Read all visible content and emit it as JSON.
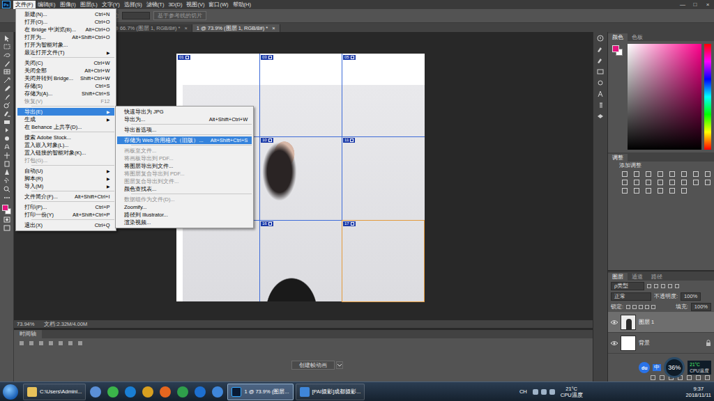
{
  "app": {
    "logo": "Ps"
  },
  "menubar": [
    {
      "label": "文件(F)",
      "selected": true
    },
    {
      "label": "编辑(E)",
      "selected": false
    },
    {
      "label": "图像(I)",
      "selected": false
    },
    {
      "label": "图层(L)",
      "selected": false
    },
    {
      "label": "文字(Y)",
      "selected": false
    },
    {
      "label": "选择(S)",
      "selected": false
    },
    {
      "label": "滤镜(T)",
      "selected": false
    },
    {
      "label": "3D(D)",
      "selected": false
    },
    {
      "label": "视图(V)",
      "selected": false
    },
    {
      "label": "窗口(W)",
      "selected": false
    },
    {
      "label": "帮助(H)",
      "selected": false
    }
  ],
  "window_controls": [
    "—",
    "□",
    "×"
  ],
  "options_bar": {
    "height_label": "高度:",
    "guide_button": "基于参考线的切片"
  },
  "doc_tabs": [
    {
      "label": "1 @ 66.7% (图层 1, RGB/8#) *",
      "close": "×",
      "selected": false
    },
    {
      "label": "1 @ 73.9% (图层 1, RGB/8#) *",
      "close": "×",
      "selected": true
    }
  ],
  "file_menu": [
    {
      "kind": "item",
      "label": "新建(N)...",
      "shortcut": "Ctrl+N",
      "disabled": false,
      "selected": false
    },
    {
      "kind": "item",
      "label": "打开(O)...",
      "shortcut": "Ctrl+O",
      "disabled": false,
      "selected": false
    },
    {
      "kind": "item",
      "label": "在 Bridge 中浏览(B)...",
      "shortcut": "Alt+Ctrl+O",
      "disabled": false,
      "selected": false
    },
    {
      "kind": "item",
      "label": "打开为...",
      "shortcut": "Alt+Shift+Ctrl+O",
      "disabled": false,
      "selected": false
    },
    {
      "kind": "item",
      "label": "打开为智能对象...",
      "disabled": false,
      "selected": false
    },
    {
      "kind": "item",
      "label": "最近打开文件(T)",
      "arrow": "▶",
      "disabled": false,
      "selected": false
    },
    {
      "kind": "separator"
    },
    {
      "kind": "item",
      "label": "关闭(C)",
      "shortcut": "Ctrl+W",
      "disabled": false,
      "selected": false
    },
    {
      "kind": "item",
      "label": "关闭全部",
      "shortcut": "Alt+Ctrl+W",
      "disabled": false,
      "selected": false
    },
    {
      "kind": "item",
      "label": "关闭并转到 Bridge...",
      "shortcut": "Shift+Ctrl+W",
      "disabled": false,
      "selected": false
    },
    {
      "kind": "item",
      "label": "存储(S)",
      "shortcut": "Ctrl+S",
      "disabled": false,
      "selected": false
    },
    {
      "kind": "item",
      "label": "存储为(A)...",
      "shortcut": "Shift+Ctrl+S",
      "disabled": false,
      "selected": false
    },
    {
      "kind": "item",
      "label": "恢复(V)",
      "shortcut": "F12",
      "disabled": true,
      "selected": false
    },
    {
      "kind": "separator"
    },
    {
      "kind": "item",
      "label": "导出(E)",
      "arrow": "▶",
      "disabled": false,
      "selected": true
    },
    {
      "kind": "item",
      "label": "生成",
      "arrow": "▶",
      "disabled": false,
      "selected": false
    },
    {
      "kind": "item",
      "label": "在 Behance 上共享(D)...",
      "disabled": false,
      "selected": false
    },
    {
      "kind": "separator"
    },
    {
      "kind": "item",
      "label": "搜索 Adobe Stock...",
      "disabled": false,
      "selected": false
    },
    {
      "kind": "item",
      "label": "置入嵌入对象(L)...",
      "disabled": false,
      "selected": false
    },
    {
      "kind": "item",
      "label": "置入链接的智能对象(K)...",
      "disabled": false,
      "selected": false
    },
    {
      "kind": "item",
      "label": "打包(G)...",
      "disabled": true,
      "selected": false
    },
    {
      "kind": "separator"
    },
    {
      "kind": "item",
      "label": "自动(U)",
      "arrow": "▶",
      "disabled": false,
      "selected": false
    },
    {
      "kind": "item",
      "label": "脚本(R)",
      "arrow": "▶",
      "disabled": false,
      "selected": false
    },
    {
      "kind": "item",
      "label": "导入(M)",
      "arrow": "▶",
      "disabled": false,
      "selected": false
    },
    {
      "kind": "separator"
    },
    {
      "kind": "item",
      "label": "文件简介(F)...",
      "shortcut": "Alt+Shift+Ctrl+I",
      "disabled": false,
      "selected": false
    },
    {
      "kind": "separator"
    },
    {
      "kind": "item",
      "label": "打印(P)...",
      "shortcut": "Ctrl+P",
      "disabled": false,
      "selected": false
    },
    {
      "kind": "item",
      "label": "打印一份(Y)",
      "shortcut": "Alt+Shift+Ctrl+P",
      "disabled": false,
      "selected": false
    },
    {
      "kind": "separator"
    },
    {
      "kind": "item",
      "label": "退出(X)",
      "shortcut": "Ctrl+Q",
      "disabled": false,
      "selected": false
    }
  ],
  "export_submenu": [
    {
      "kind": "item",
      "label": "快速导出为 JPG",
      "disabled": false,
      "selected": false
    },
    {
      "kind": "item",
      "label": "导出为...",
      "shortcut": "Alt+Shift+Ctrl+W",
      "disabled": false,
      "selected": false
    },
    {
      "kind": "separator"
    },
    {
      "kind": "item",
      "label": "导出首选项...",
      "disabled": false,
      "selected": false
    },
    {
      "kind": "separator"
    },
    {
      "kind": "item",
      "label": "存储为 Web 所用格式（旧版）...",
      "shortcut": "Alt+Shift+Ctrl+S",
      "disabled": false,
      "selected": true
    },
    {
      "kind": "separator"
    },
    {
      "kind": "item",
      "label": "画板至文件...",
      "disabled": true,
      "selected": false
    },
    {
      "kind": "item",
      "label": "将画板导出到 PDF...",
      "disabled": true,
      "selected": false
    },
    {
      "kind": "item",
      "label": "将图层导出到文件...",
      "disabled": false,
      "selected": false
    },
    {
      "kind": "item",
      "label": "将图层复合导出到 PDF...",
      "disabled": true,
      "selected": false
    },
    {
      "kind": "item",
      "label": "图层复合导出到文件...",
      "disabled": true,
      "selected": false
    },
    {
      "kind": "item",
      "label": "颜色查找表...",
      "disabled": false,
      "selected": false
    },
    {
      "kind": "separator"
    },
    {
      "kind": "item",
      "label": "数据组作为文件(D)...",
      "disabled": true,
      "selected": false
    },
    {
      "kind": "item",
      "label": "Zoomify...",
      "disabled": false,
      "selected": false
    },
    {
      "kind": "item",
      "label": "路径到 Illustrator...",
      "disabled": false,
      "selected": false
    },
    {
      "kind": "item",
      "label": "渲染视频...",
      "disabled": false,
      "selected": false
    }
  ],
  "slices": [
    {
      "label": "01",
      "selected": false
    },
    {
      "label": "03",
      "selected": false
    },
    {
      "label": "05",
      "selected": false
    },
    {
      "label": "10",
      "selected": false
    },
    {
      "label": "11",
      "selected": false
    },
    {
      "label": "16",
      "selected": false
    },
    {
      "label": "17",
      "selected": true
    }
  ],
  "status": {
    "zoom": "73.94%",
    "doc": "文档:2.32M/4.00M"
  },
  "timeline": {
    "title": "时间轴",
    "button": "创建帧动画"
  },
  "color_panel": {
    "tabs": [
      {
        "label": "颜色",
        "selected": true
      },
      {
        "label": "色板",
        "selected": false
      }
    ]
  },
  "adjust_panel": {
    "title": "调整",
    "subtitle": "添加调整"
  },
  "layers_panel": {
    "tabs": [
      {
        "label": "图层",
        "selected": true
      },
      {
        "label": "通道",
        "selected": false
      },
      {
        "label": "路径",
        "selected": false
      }
    ],
    "filter": "ρ类型",
    "blend": "正常",
    "opacity_label": "不透明度:",
    "opacity": "100%",
    "lock_label": "锁定:",
    "fill_label": "填充:",
    "fill": "100%",
    "layers": [
      {
        "name": "图层 1",
        "selected": true,
        "visible": true,
        "locked": false
      },
      {
        "name": "背景",
        "selected": false,
        "visible": true,
        "locked": true
      }
    ]
  },
  "taskbar": {
    "items": [
      {
        "label": "C:\\Users\\Admini...",
        "selected": false
      },
      {
        "label": "1 @ 73.9% (图层...",
        "selected": true
      },
      {
        "label": "[PAI摄影]成都摄影...",
        "selected": false
      }
    ],
    "lang": "CH",
    "temp": "21°C",
    "temp_label": "CPU温度",
    "time": "9:37",
    "date": "2018/11/11"
  },
  "widget": {
    "baidu": "du",
    "ime": "中",
    "percent": "36%",
    "temp": "21°C",
    "label": "CPU温度"
  }
}
